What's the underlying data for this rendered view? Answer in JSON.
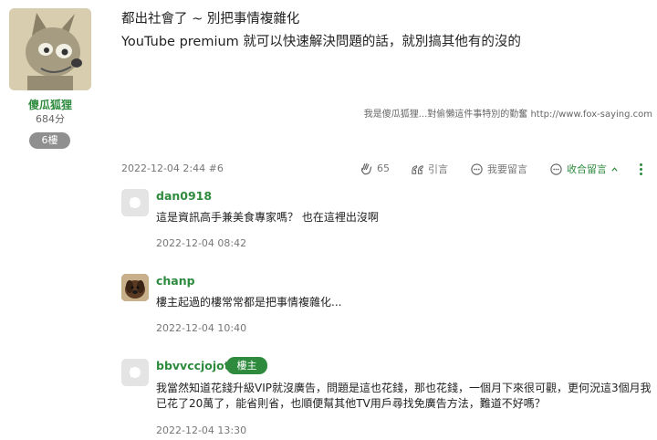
{
  "author": {
    "name": "傻瓜狐狸",
    "points": "684分",
    "floor": "6樓"
  },
  "post": {
    "line1": "都出社會了 ~ 別把事情複雜化",
    "line2": "YouTube premium 就可以快速解決問題的話，就別搞其他有的沒的",
    "signature": "我是傻瓜狐狸...對偷懶這件事特別的勤奮 http://www.fox-saying.com",
    "date": "2022-12-04 2:44 #6"
  },
  "actions": {
    "likes": "65",
    "quote": "引言",
    "reply": "我要留言",
    "collapse": "收合留言"
  },
  "comments": [
    {
      "name": "dan0918",
      "text": "這是資訊高手兼美食專家嗎？ 也在這裡出沒啊",
      "date": "2022-12-04 08:42"
    },
    {
      "name": "chanp",
      "text": "樓主起過的樓常常都是把事情複雜化...",
      "date": "2022-12-04 10:40"
    },
    {
      "name": "bbvvccjojotv",
      "badge": "樓主",
      "text_line1": "我當然知道花錢升級VIP就沒廣告，問題是這也花錢，那也花錢，一個月下來很可觀，更何況這3個月我",
      "text_line2": "已花了20萬了，能省則省，也順便幫其他TV用戶尋找免廣告方法，難道不好嗎？",
      "date": "2022-12-04 13:30"
    }
  ],
  "colors": {
    "accent": "#2e8b3e",
    "badge_gray": "#8f8f8f",
    "muted": "#777777"
  },
  "icons": [
    "clap-icon",
    "quote-icon",
    "comment-icon",
    "collapse-comment-icon",
    "chevron-up-icon",
    "more-vertical-icon",
    "default-avatar-icon"
  ]
}
